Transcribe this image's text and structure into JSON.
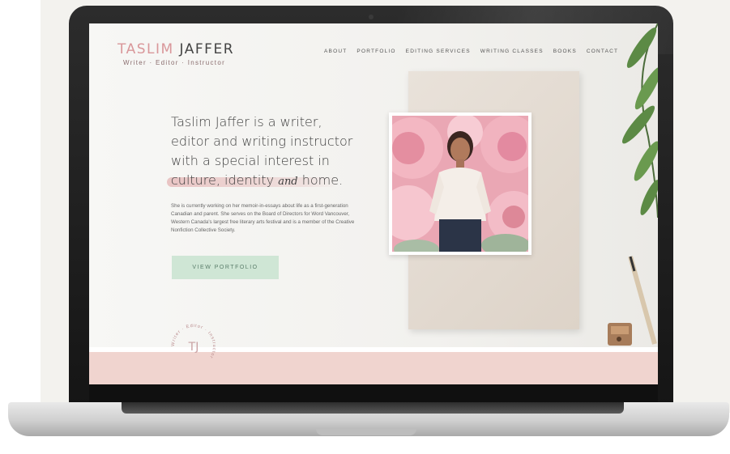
{
  "site": {
    "logo_first": "TASLIM",
    "logo_last": "JAFFER",
    "tagline": "Writer · Editor · Instructor"
  },
  "nav": {
    "items": [
      "ABOUT",
      "PORTFOLIO",
      "EDITING SERVICES",
      "WRITING CLASSES",
      "BOOKS",
      "CONTACT"
    ]
  },
  "hero": {
    "headline_line1": "Taslim Jaffer is a writer,",
    "headline_line2": "editor and writing instructor",
    "headline_line3": "with a special interest in",
    "headline_line4_a": "culture, identity",
    "headline_line4_and": "and",
    "headline_line4_b": "home.",
    "bio": "She is currently working on her memoir-in-essays about life as a first-generation Canadian and parent. She serves on the Board of Directors for Word Vancouver, Western Canada's largest free literary arts festival and is a member of the Creative Nonfiction Collective Society.",
    "cta_label": "VIEW PORTFOLIO"
  },
  "badge": {
    "monogram": "TJ",
    "ring_text": "Writer · Editor · Instructor"
  },
  "icons": {
    "badge": "monogram-seal-icon",
    "photo": "portrait-photo"
  },
  "colors": {
    "accent_pink": "#d9979a",
    "band_pink": "#f0d4cf",
    "button_green": "#cfe6d5"
  }
}
